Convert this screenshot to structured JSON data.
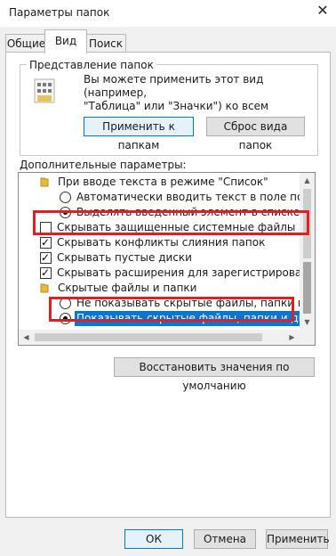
{
  "window": {
    "title": "Параметры папок",
    "close_glyph": "✕"
  },
  "tabs": [
    {
      "label": "Общие",
      "active": false
    },
    {
      "label": "Вид",
      "active": true
    },
    {
      "label": "Поиск",
      "active": false
    }
  ],
  "folder_views": {
    "legend": "Представление папок",
    "description": "Вы можете применить этот вид (например,\n\"Таблица\" или \"Значки\") ко всем папкам\nтакого типа.",
    "apply_button": "Применить к папкам",
    "reset_button": "Сброс вида папок"
  },
  "advanced": {
    "label": "Дополнительные параметры:",
    "items": [
      {
        "type": "folder",
        "label": "При вводе текста в режиме \"Список\""
      },
      {
        "type": "radio",
        "checked": false,
        "label": "Автоматически вводить текст в поле поиска"
      },
      {
        "type": "radio",
        "checked": true,
        "label": "Выделять введенный элемент в списке"
      },
      {
        "type": "checkbox",
        "checked": false,
        "label": "Скрывать защищенные системные файлы (рекомен,"
      },
      {
        "type": "checkbox",
        "checked": true,
        "label": "Скрывать конфликты слияния папок"
      },
      {
        "type": "checkbox",
        "checked": true,
        "label": "Скрывать пустые диски"
      },
      {
        "type": "checkbox",
        "checked": true,
        "label": "Скрывать расширения для зарегистрированных типо"
      },
      {
        "type": "folder",
        "label": "Скрытые файлы и папки"
      },
      {
        "type": "radio",
        "checked": false,
        "label": "Не показывать скрытые файлы, папки и диски"
      },
      {
        "type": "radio",
        "checked": true,
        "label": "Показывать скрытые файлы, папки и диски"
      }
    ],
    "restore_button": "Восстановить значения по умолчанию"
  },
  "footer": {
    "ok": "ОК",
    "cancel": "Отмена",
    "apply": "Применить"
  },
  "colors": {
    "highlight": "#e02020",
    "selection": "#0078d7"
  }
}
